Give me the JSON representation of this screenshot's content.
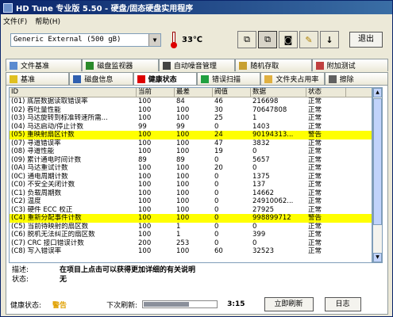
{
  "window": {
    "title": "HD Tune 专业版 5.50 - 硬盘/固态硬盘实用程序"
  },
  "menu": {
    "file": "文件(F)",
    "help": "帮助(H)"
  },
  "toolbar": {
    "drive": "Generic External  (500 gB)",
    "temperature": "33℃",
    "exit_label": "退出"
  },
  "tabs_row1": [
    {
      "label": "文件基准",
      "icon": "file-benchmark-icon"
    },
    {
      "label": "磁盘监视器",
      "icon": "disk-monitor-icon"
    },
    {
      "label": "自动噪音管理",
      "icon": "speaker-icon"
    },
    {
      "label": "随机存取",
      "icon": "random-access-icon"
    },
    {
      "label": "附加测试",
      "icon": "extra-tests-icon"
    }
  ],
  "tabs_row2": [
    {
      "label": "基准",
      "icon": "benchmark-icon"
    },
    {
      "label": "磁盘信息",
      "icon": "info-icon"
    },
    {
      "label": "健康状态",
      "icon": "health-cross-icon"
    },
    {
      "label": "错误扫描",
      "icon": "error-scan-icon"
    },
    {
      "label": "文件夹占用率",
      "icon": "folder-icon"
    },
    {
      "label": "擦除",
      "icon": "erase-icon"
    }
  ],
  "table": {
    "headers": [
      "ID",
      "当前",
      "最差",
      "阀值",
      "数据",
      "状态"
    ],
    "rows": [
      {
        "id": "(01) 底层数据读取错误率",
        "cur": "100",
        "worst": "84",
        "thr": "46",
        "data": "216698",
        "status": "正常",
        "warn": false
      },
      {
        "id": "(02) 吞吐量性能",
        "cur": "100",
        "worst": "100",
        "thr": "30",
        "data": "70647808",
        "status": "正常",
        "warn": false
      },
      {
        "id": "(03) 马达旋转到标准转速所需...",
        "cur": "100",
        "worst": "100",
        "thr": "25",
        "data": "1",
        "status": "正常",
        "warn": false
      },
      {
        "id": "(04) 马达启动/停止计数",
        "cur": "99",
        "worst": "99",
        "thr": "0",
        "data": "1403",
        "status": "正常",
        "warn": false
      },
      {
        "id": "(05) 重映射扇区计数",
        "cur": "100",
        "worst": "100",
        "thr": "24",
        "data": "90194313...",
        "status": "警告",
        "warn": true
      },
      {
        "id": "(07) 寻道错误率",
        "cur": "100",
        "worst": "100",
        "thr": "47",
        "data": "3832",
        "status": "正常",
        "warn": false
      },
      {
        "id": "(08) 寻道性能",
        "cur": "100",
        "worst": "100",
        "thr": "19",
        "data": "0",
        "status": "正常",
        "warn": false
      },
      {
        "id": "(09) 累计通电时间计数",
        "cur": "89",
        "worst": "89",
        "thr": "0",
        "data": "5657",
        "status": "正常",
        "warn": false
      },
      {
        "id": "(0A) 马达重试计数",
        "cur": "100",
        "worst": "100",
        "thr": "20",
        "data": "0",
        "status": "正常",
        "warn": false
      },
      {
        "id": "(0C) 通电周期计数",
        "cur": "100",
        "worst": "100",
        "thr": "0",
        "data": "1375",
        "status": "正常",
        "warn": false
      },
      {
        "id": "(C0) 不安全关闭计数",
        "cur": "100",
        "worst": "100",
        "thr": "0",
        "data": "137",
        "status": "正常",
        "warn": false
      },
      {
        "id": "(C1) 负载周期数",
        "cur": "100",
        "worst": "100",
        "thr": "0",
        "data": "14662",
        "status": "正常",
        "warn": false
      },
      {
        "id": "(C2) 温度",
        "cur": "100",
        "worst": "100",
        "thr": "0",
        "data": "24910062...",
        "status": "正常",
        "warn": false
      },
      {
        "id": "(C3) 硬件 ECC 校正",
        "cur": "100",
        "worst": "100",
        "thr": "0",
        "data": "27925",
        "status": "正常",
        "warn": false
      },
      {
        "id": "(C4) 重新分配事件计数",
        "cur": "100",
        "worst": "100",
        "thr": "0",
        "data": "998899712",
        "status": "警告",
        "warn": true
      },
      {
        "id": "(C5) 当前待映射的扇区数",
        "cur": "100",
        "worst": "1",
        "thr": "0",
        "data": "0",
        "status": "正常",
        "warn": false
      },
      {
        "id": "(C6) 脱机无法纠正的扇区数",
        "cur": "100",
        "worst": "1",
        "thr": "0",
        "data": "399",
        "status": "正常",
        "warn": false
      },
      {
        "id": "(C7) CRC 接口错误计数",
        "cur": "200",
        "worst": "253",
        "thr": "0",
        "data": "0",
        "status": "正常",
        "warn": false
      },
      {
        "id": "(C8) 写入错误率",
        "cur": "100",
        "worst": "100",
        "thr": "60",
        "data": "32523",
        "status": "正常",
        "warn": false
      }
    ]
  },
  "details": {
    "desc_label": "描述:",
    "desc_value": "在项目上点击可以获得更加详细的有关说明",
    "status_label": "状态:",
    "status_value": "无"
  },
  "footer": {
    "health_label": "健康状态:",
    "health_value": "警告",
    "next_refresh_label": "下次刷新:",
    "countdown": "3:15",
    "refresh_label": "立即刷新",
    "log_label": "日志",
    "refresh_progress": 0.62
  },
  "colors": {
    "warn_row": "#ffff00",
    "health_warn": "#e0a000"
  }
}
